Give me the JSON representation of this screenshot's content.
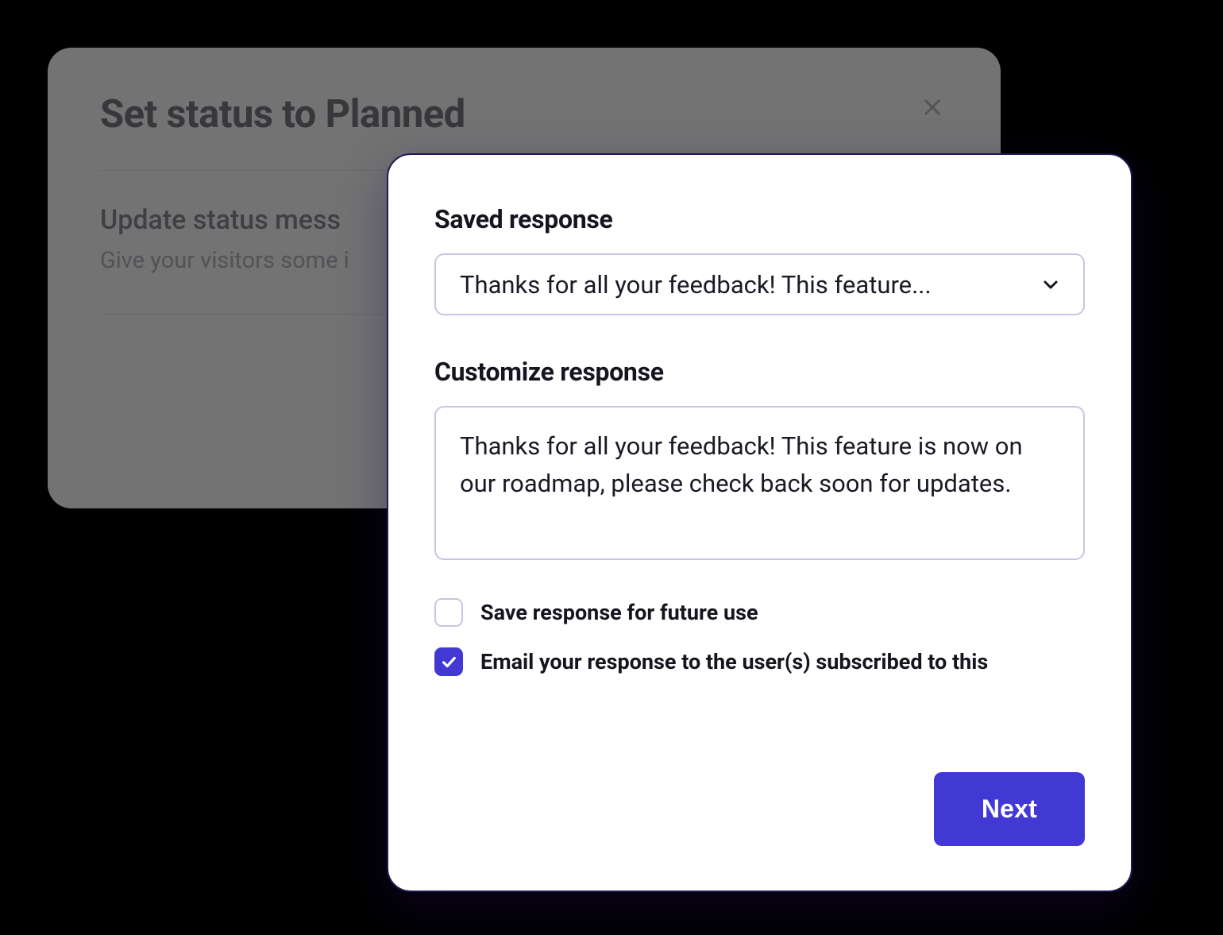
{
  "back_modal": {
    "title": "Set status to Planned",
    "subtitle": "Update status mess",
    "helper": "Give your visitors some i"
  },
  "front_modal": {
    "saved_response": {
      "label": "Saved response",
      "selected": "Thanks for all your feedback! This feature..."
    },
    "customize": {
      "label": "Customize response",
      "value": "Thanks for all your feedback! This feature is now on our roadmap, please check back soon for updates."
    },
    "checkboxes": {
      "save_future": {
        "label": "Save response for future use",
        "checked": false
      },
      "email_users": {
        "label": "Email your response to the user(s) subscribed to this",
        "checked": true
      }
    },
    "next_label": "Next"
  },
  "colors": {
    "accent": "#4238d4",
    "border_soft": "#c8c4e8",
    "text_primary": "#151520"
  }
}
